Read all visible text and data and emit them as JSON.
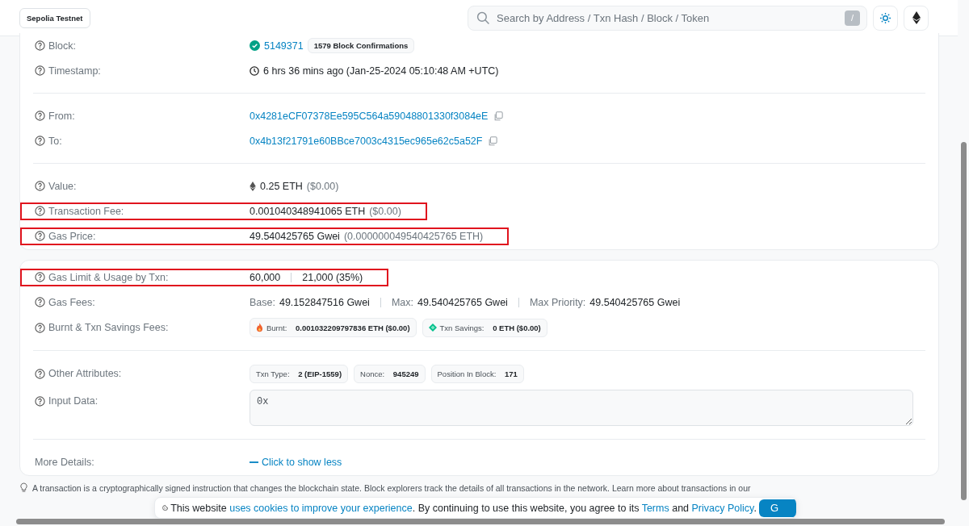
{
  "header": {
    "network_badge": "Sepolia Testnet",
    "search": {
      "placeholder": "Search by Address / Txn Hash / Block / Token",
      "shortcut": "/"
    }
  },
  "cards": [
    {
      "sections": [
        [
          {
            "label": "Block:",
            "help": true,
            "highlighted": false,
            "kind": "block",
            "link": "5149371",
            "badge": "1579 Block Confirmations"
          },
          {
            "label": "Timestamp:",
            "help": true,
            "highlighted": false,
            "kind": "timestamp",
            "text": "6 hrs 36 mins ago (Jan-25-2024 05:10:48 AM +UTC)"
          }
        ],
        [
          {
            "label": "From:",
            "help": true,
            "highlighted": false,
            "kind": "address",
            "link": "0x4281eCF07378Ee595C564a59048801330f3084eE"
          },
          {
            "label": "To:",
            "help": true,
            "highlighted": false,
            "kind": "address",
            "link": "0x4b13f21791e60BBce7003c4315ec965e62c5a52F"
          }
        ],
        [
          {
            "label": "Value:",
            "help": true,
            "highlighted": false,
            "kind": "eth",
            "amount": "0.25 ETH",
            "fiat": "($0.00)"
          },
          {
            "label": "Transaction Fee:",
            "help": true,
            "highlighted": true,
            "kind": "amount",
            "amount": "0.001040348941065 ETH",
            "fiat": "($0.00)"
          },
          {
            "label": "Gas Price:",
            "help": true,
            "highlighted": true,
            "kind": "amount",
            "amount": "49.540425765 Gwei",
            "fiat": "(0.000000049540425765 ETH)"
          }
        ]
      ]
    },
    {
      "sections": [
        [
          {
            "label": "Gas Limit & Usage by Txn:",
            "help": true,
            "highlighted": true,
            "kind": "segments",
            "segments": [
              {
                "value": "60,000"
              },
              {
                "value": "21,000 (35%)"
              }
            ]
          },
          {
            "label": "Gas Fees:",
            "help": true,
            "highlighted": false,
            "kind": "segments",
            "segments": [
              {
                "label": "Base:",
                "value": "49.152847516 Gwei"
              },
              {
                "label": "Max:",
                "value": "49.540425765 Gwei"
              },
              {
                "label": "Max Priority:",
                "value": "49.540425765 Gwei"
              }
            ]
          },
          {
            "label": "Burnt & Txn Savings Fees:",
            "help": true,
            "highlighted": false,
            "kind": "badges",
            "badges": [
              {
                "kind": "burnt",
                "label": "Burnt:",
                "value": "0.001032209797836 ETH ($0.00)"
              },
              {
                "kind": "savings",
                "label": "Txn Savings:",
                "value": "0 ETH ($0.00)"
              }
            ]
          }
        ],
        [
          {
            "label": "Other Attributes:",
            "help": true,
            "highlighted": false,
            "kind": "badges",
            "badges": [
              {
                "kind": "attribute",
                "label": "Txn Type:",
                "value": "2 (EIP-1559)"
              },
              {
                "kind": "attribute",
                "label": "Nonce:",
                "value": "945249"
              },
              {
                "kind": "attribute",
                "label": "Position In Block:",
                "value": "171"
              }
            ]
          },
          {
            "label": "Input Data:",
            "help": true,
            "highlighted": false,
            "kind": "textarea",
            "value": "0x"
          }
        ],
        [
          {
            "label": "More Details:",
            "help": false,
            "highlighted": false,
            "kind": "toggle",
            "link": "Click to show less"
          }
        ]
      ]
    }
  ],
  "footer_note": "A transaction is a cryptographically signed instruction that changes the blockchain state. Block explorers track the details of all transactions in the network. Learn more about transactions in our",
  "cookie_banner": {
    "text_before": "This website",
    "link_1": "uses cookies to improve your experience",
    "text_middle": ". By continuing to use this website, you agree to its",
    "link_2": "Terms",
    "text_and": "and",
    "link_3": "Privacy Policy",
    "text_end": ".",
    "button": "G"
  }
}
